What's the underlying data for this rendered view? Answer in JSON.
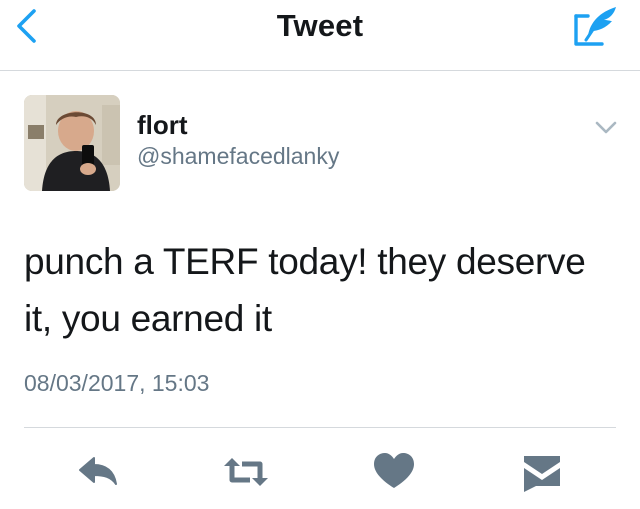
{
  "nav": {
    "title": "Tweet",
    "back_icon": "chevron-left-icon",
    "compose_icon": "compose-tweet-icon",
    "accent_color": "#1da1f2"
  },
  "tweet": {
    "author": {
      "display_name": "flort",
      "handle": "@shamefacedlanky"
    },
    "text_lines": [
      "punch a TERF today! they deserve",
      "it, you earned it"
    ],
    "timestamp": "08/03/2017, 15:03"
  },
  "actions": [
    {
      "icon": "reply-icon"
    },
    {
      "icon": "retweet-icon"
    },
    {
      "icon": "like-heart-icon"
    },
    {
      "icon": "direct-message-icon"
    }
  ],
  "colors": {
    "text_primary": "#14171a",
    "text_secondary": "#657786",
    "icon_gray": "#657786",
    "divider": "#d5d9dd"
  }
}
